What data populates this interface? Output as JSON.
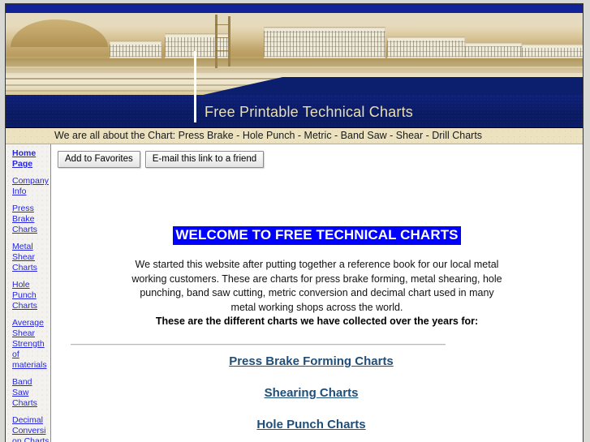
{
  "banner": {
    "title": "Free Printable Technical Charts",
    "photo_alt": "industrial-construction-photo"
  },
  "tagline": "We are all about the Chart: Press Brake - Hole Punch - Metric - Band Saw - Shear - Drill Charts",
  "sidebar": {
    "items": [
      {
        "label": "Home Page",
        "current": true
      },
      {
        "label": "Company Info",
        "current": false
      },
      {
        "label": "Press Brake Charts",
        "current": false
      },
      {
        "label": "Metal Shear Charts",
        "current": false
      },
      {
        "label": "Hole Punch Charts",
        "current": false
      },
      {
        "label": "Average Shear Strength of materials",
        "current": false
      },
      {
        "label": "Band Saw Charts",
        "current": false
      },
      {
        "label": "Decimal Conversion Charts",
        "current": false
      }
    ]
  },
  "toolbar": {
    "add_to_favorites_label": "Add to Favorites",
    "email_link_label": "E-mail this link to a friend"
  },
  "main": {
    "welcome_title": "WELCOME TO FREE TECHNICAL CHARTS",
    "intro_paragraph": "We started this website after putting together a reference book for our local metal working customers.  These are charts for press brake forming, metal shearing, hole punching, band saw cutting, metric conversion and decimal chart used in many metal working shops across the world.",
    "intro_bold": "These are the different charts we have collected over the years for:",
    "chart_links": [
      "Press Brake Forming Charts",
      "Shearing Charts",
      "Hole Punch Charts"
    ]
  },
  "colors": {
    "banner_blue": "#0b1f6e",
    "banner_title_text": "#e8e0b4",
    "tagline_bg": "#ece2bf",
    "sidebar_link": "#2626e0",
    "chart_link": "#1f4e79",
    "highlight_bg": "#0000ff",
    "highlight_text": "#ffffff"
  }
}
